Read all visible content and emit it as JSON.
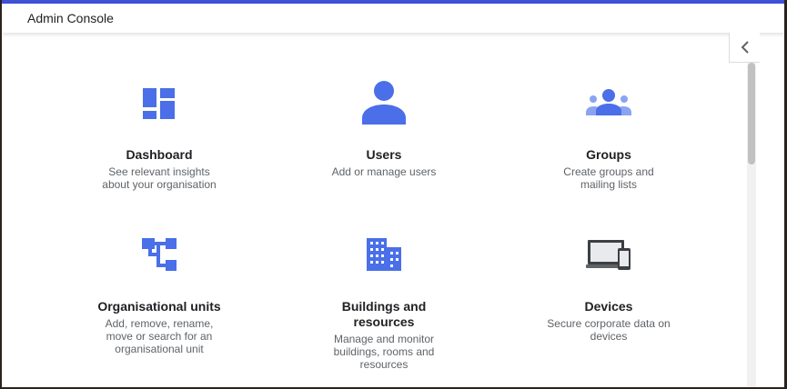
{
  "header": {
    "title": "Admin Console"
  },
  "colors": {
    "accent": "#3f51d6",
    "icon": "#4a6fe8"
  },
  "cards": [
    {
      "title": "Dashboard",
      "desc": "See relevant insights about your organisation",
      "icon": "dashboard-icon"
    },
    {
      "title": "Users",
      "desc": "Add or manage users",
      "icon": "user-icon"
    },
    {
      "title": "Groups",
      "desc": "Create groups and mailing lists",
      "icon": "groups-icon"
    },
    {
      "title": "Organisational units",
      "desc": "Add, remove, rename, move or search for an organisational unit",
      "icon": "org-units-icon"
    },
    {
      "title": "Buildings and resources",
      "desc": "Manage and monitor buildings, rooms and resources",
      "icon": "building-icon"
    },
    {
      "title": "Devices",
      "desc": "Secure corporate data on devices",
      "icon": "devices-icon"
    }
  ]
}
